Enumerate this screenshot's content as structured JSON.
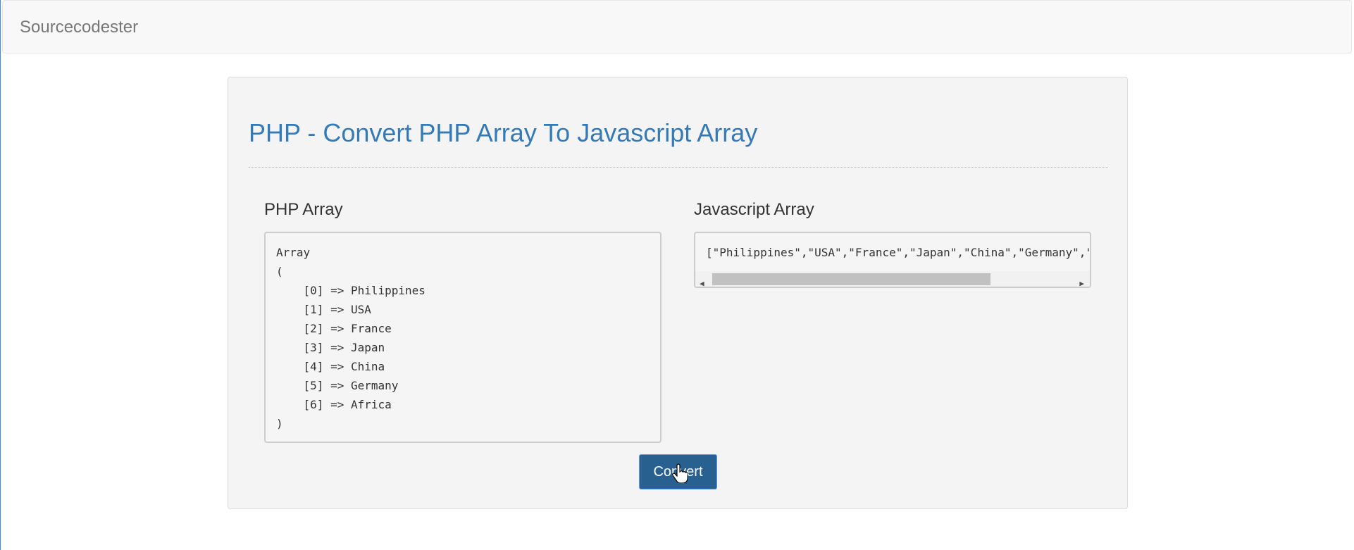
{
  "navbar": {
    "brand": "Sourcecodester"
  },
  "main": {
    "title": "PHP - Convert PHP Array To Javascript Array",
    "php_heading": "PHP Array",
    "js_heading": "Javascript Array",
    "php_output": "Array\n(\n    [0] => Philippines\n    [1] => USA\n    [2] => France\n    [3] => Japan\n    [4] => China\n    [5] => Germany\n    [6] => Africa\n)",
    "js_output": "[\"Philippines\",\"USA\",\"France\",\"Japan\",\"China\",\"Germany\",\"Africa\"]",
    "convert_label": "Convert"
  },
  "colors": {
    "accent": "#337ab7",
    "button": "#286090"
  }
}
